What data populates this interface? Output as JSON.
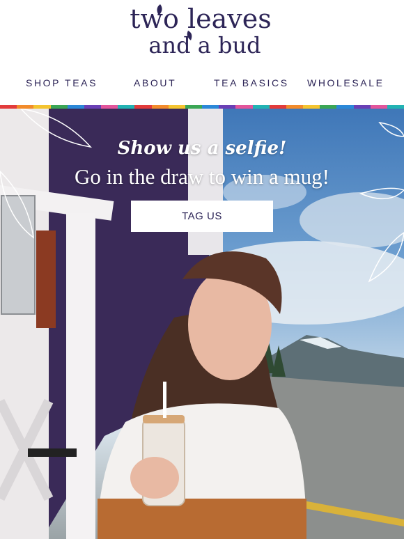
{
  "brand": {
    "logo_line1": "two leaves",
    "logo_line2": "and a bud"
  },
  "nav": {
    "items": [
      {
        "label": "SHOP TEAS"
      },
      {
        "label": "ABOUT"
      },
      {
        "label": "TEA BASICS"
      },
      {
        "label": "WHOLESALE"
      }
    ]
  },
  "stripe_colors": [
    "#e23b3b",
    "#f28b2b",
    "#f4c430",
    "#3aa655",
    "#2b88d8",
    "#6a3fb5",
    "#e2559b",
    "#22b3b3",
    "#e23b3b",
    "#f28b2b",
    "#f4c430",
    "#3aa655",
    "#2b88d8",
    "#6a3fb5",
    "#e2559b",
    "#22b3b3",
    "#e23b3b",
    "#f28b2b",
    "#f4c430",
    "#3aa655",
    "#2b88d8",
    "#6a3fb5",
    "#e2559b",
    "#22b3b3"
  ],
  "hero": {
    "headline_line1": "Show us a selfie!",
    "headline_line2": "Go in the draw to win a mug!",
    "cta_label": "TAG US"
  },
  "colors": {
    "brand_navy": "#2d2557",
    "text_white": "#ffffff"
  }
}
